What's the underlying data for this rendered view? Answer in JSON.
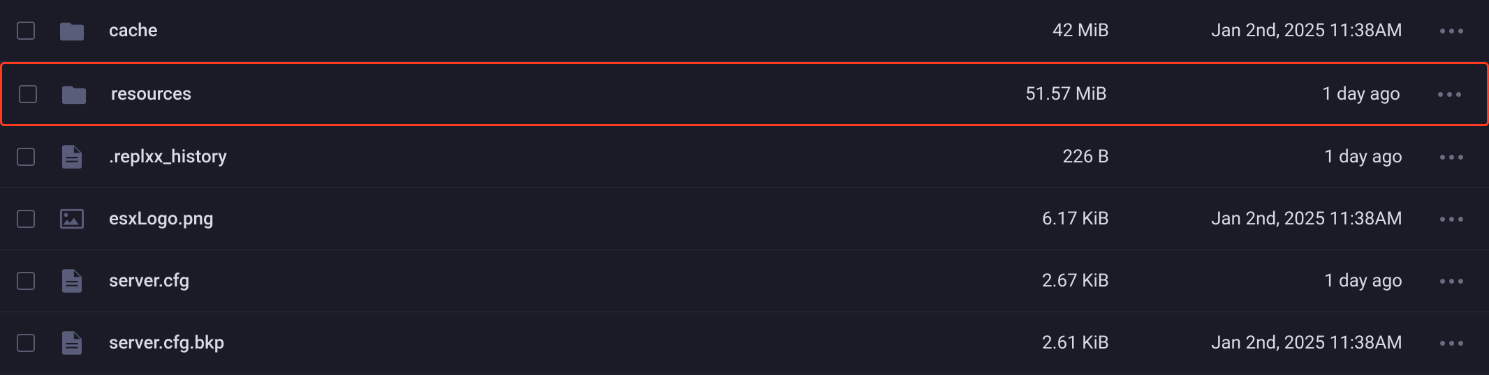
{
  "files": [
    {
      "name": "cache",
      "type": "folder",
      "size": "42 MiB",
      "date": "Jan 2nd, 2025 11:38AM",
      "highlighted": false
    },
    {
      "name": "resources",
      "type": "folder",
      "size": "51.57 MiB",
      "date": "1 day ago",
      "highlighted": true
    },
    {
      "name": ".replxx_history",
      "type": "file",
      "size": "226 B",
      "date": "1 day ago",
      "highlighted": false
    },
    {
      "name": "esxLogo.png",
      "type": "image",
      "size": "6.17 KiB",
      "date": "Jan 2nd, 2025 11:38AM",
      "highlighted": false
    },
    {
      "name": "server.cfg",
      "type": "file",
      "size": "2.67 KiB",
      "date": "1 day ago",
      "highlighted": false
    },
    {
      "name": "server.cfg.bkp",
      "type": "file",
      "size": "2.61 KiB",
      "date": "Jan 2nd, 2025 11:38AM",
      "highlighted": false
    }
  ]
}
